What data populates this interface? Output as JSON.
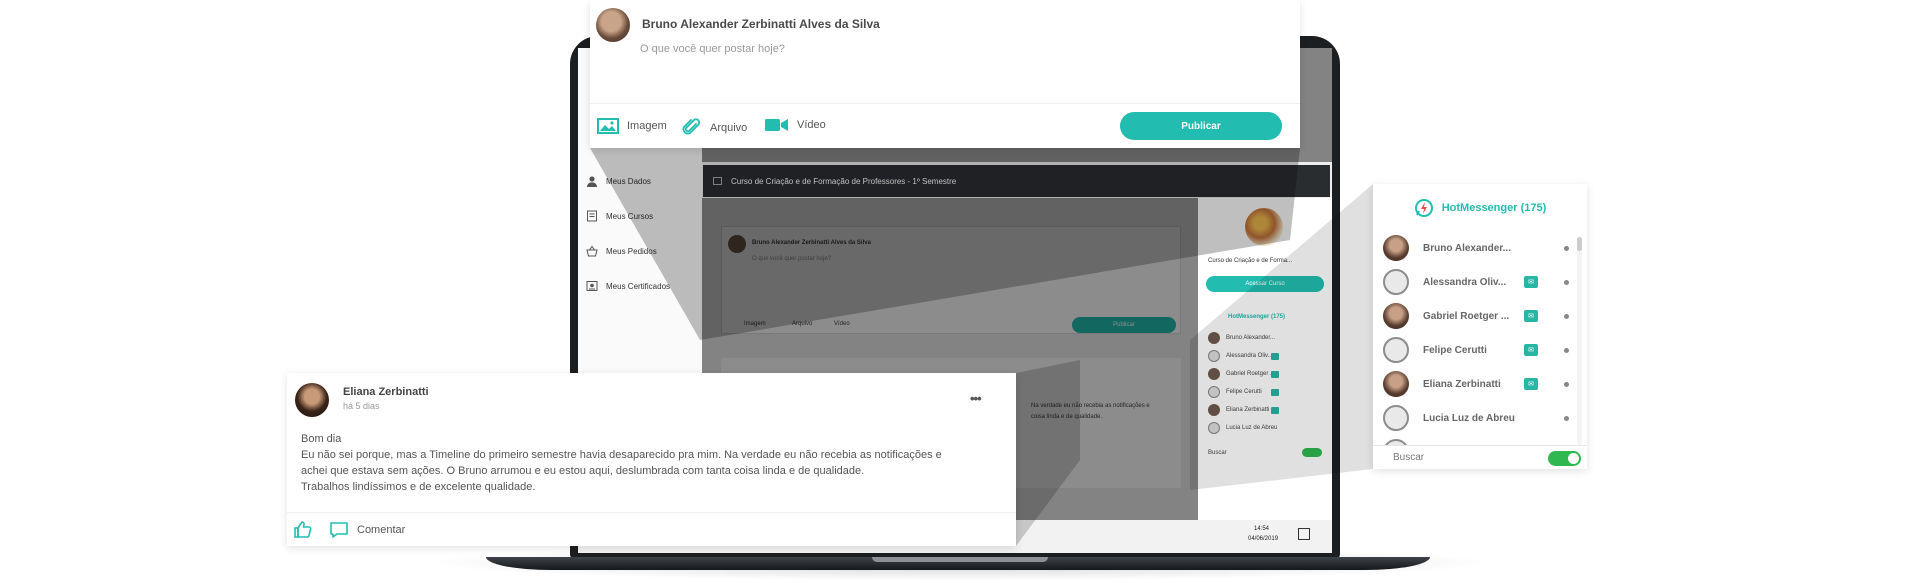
{
  "composer": {
    "author": "Bruno Alexander Zerbinatti Alves da Silva",
    "placeholder": "O que você quer postar hoje?",
    "tools": {
      "image": "Imagem",
      "file": "Arquivo",
      "video": "Vídeo"
    },
    "publish_label": "Publicar"
  },
  "sidebar": {
    "items": [
      {
        "label": "Meus Dados",
        "icon": "user-icon"
      },
      {
        "label": "Meus Cursos",
        "icon": "book-icon"
      },
      {
        "label": "Meus Pedidos",
        "icon": "basket-icon"
      },
      {
        "label": "Meus Certificados",
        "icon": "certificate-icon"
      }
    ]
  },
  "course": {
    "title": "Curso de Criação e de Formação de Professores - 1º Semestre",
    "card_title": "Curso de Criação e de Forma...",
    "access_label": "Acessar Curso"
  },
  "post": {
    "author": "Eliana Zerbinatti",
    "time": "há 5 dias",
    "body_lines": [
      "Bom dia",
      "Eu não sei porque, mas a Timeline do primeiro semestre havia desaparecido pra mim. Na verdade eu não recebia as notificações e",
      "achei que estava sem ações. O Bruno arrumou e eu estou aqui, deslumbrada com tanta coisa linda e de qualidade.",
      "Trabalhos lindíssimos e de excelente qualidade."
    ],
    "comment_label": "Comentar",
    "excerpt": [
      "Na verdade eu não recebia as notificações e",
      "coisa linda e de qualidade."
    ]
  },
  "messenger": {
    "title": "HotMessenger (175)",
    "contacts": [
      {
        "name": "Bruno Alexander...",
        "badge": false,
        "avatar": "photo"
      },
      {
        "name": "Alessandra Oliv...",
        "badge": true,
        "avatar": "generic"
      },
      {
        "name": "Gabriel Roetger ...",
        "badge": true,
        "avatar": "photo"
      },
      {
        "name": "Felipe Cerutti",
        "badge": true,
        "avatar": "generic"
      },
      {
        "name": "Eliana Zerbinatti",
        "badge": true,
        "avatar": "photo"
      },
      {
        "name": "Lucia Luz de Abreu",
        "badge": false,
        "avatar": "generic"
      }
    ],
    "mini_names": [
      "Bruno Alexander...",
      "Alessandra Oliv...",
      "Gabriel Roetger ...",
      "Felipe Cerutti",
      "Eliana Zerbinatti",
      "Lucia Luz de Abreu"
    ],
    "search_label": "Buscar",
    "toggle_on": true
  },
  "taskbar": {
    "time": "14:54",
    "date": "04/06/2019"
  },
  "colors": {
    "accent": "#22bdb0",
    "badge": "#27b6a4",
    "toggle": "#2fb84f",
    "dark_bar": "#2a2d30"
  }
}
